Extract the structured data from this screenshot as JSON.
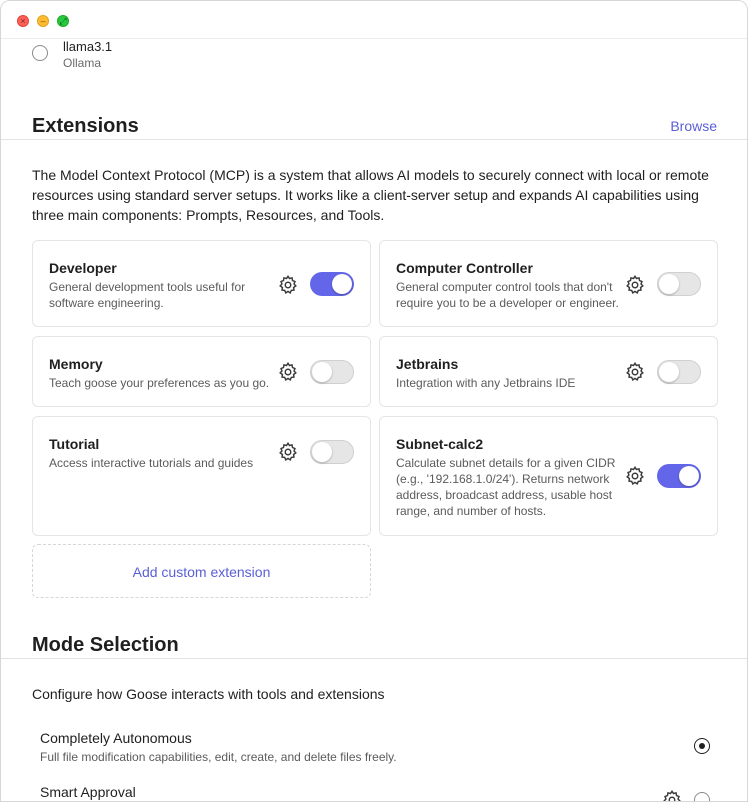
{
  "window": {
    "controls": [
      "close",
      "minimize",
      "zoom"
    ]
  },
  "model": {
    "name": "llama3.1",
    "provider": "Ollama"
  },
  "extensions": {
    "title": "Extensions",
    "browse_label": "Browse",
    "description": "The Model Context Protocol (MCP) is a system that allows AI models to securely connect with local or remote resources using standard server setups. It works like a client-server setup and expands AI capabilities using three main components: Prompts, Resources, and Tools.",
    "items": [
      {
        "title": "Developer",
        "description": "General development tools useful for software engineering.",
        "enabled": true
      },
      {
        "title": "Computer Controller",
        "description": "General computer control tools that don't require you to be a developer or engineer.",
        "enabled": false
      },
      {
        "title": "Memory",
        "description": "Teach goose your preferences as you go.",
        "enabled": false
      },
      {
        "title": "Jetbrains",
        "description": "Integration with any Jetbrains IDE",
        "enabled": false
      },
      {
        "title": "Tutorial",
        "description": "Access interactive tutorials and guides",
        "enabled": false
      },
      {
        "title": "Subnet-calc2",
        "description": "Calculate subnet details for a given CIDR (e.g., '192.168.1.0/24'). Returns network address, broadcast address, usable host range, and number of hosts.",
        "enabled": true
      }
    ],
    "add_label": "Add custom extension"
  },
  "mode": {
    "title": "Mode Selection",
    "description": "Configure how Goose interacts with tools and extensions",
    "options": [
      {
        "title": "Completely Autonomous",
        "description": "Full file modification capabilities, edit, create, and delete files freely.",
        "selected": true
      },
      {
        "title": "Smart Approval",
        "description": "",
        "selected": false
      }
    ]
  },
  "colors": {
    "accent": "#6366e8",
    "link": "#5a5fd6"
  }
}
